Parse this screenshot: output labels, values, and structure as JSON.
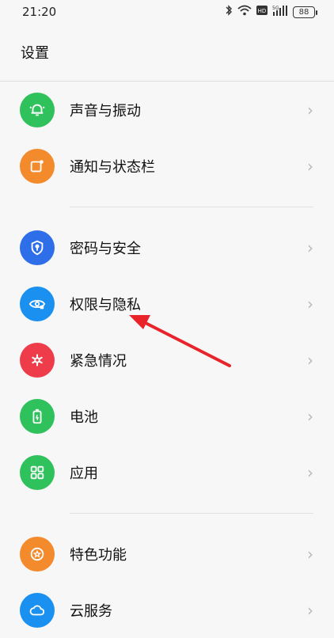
{
  "status": {
    "time": "21:20",
    "battery": "88",
    "net_label": "5G"
  },
  "header": {
    "title": "设置"
  },
  "groups": [
    [
      {
        "label": "声音与振动",
        "color": "#2fc15c",
        "icon": "bell-icon"
      },
      {
        "label": "通知与状态栏",
        "color": "#f38a2c",
        "icon": "notification-icon"
      }
    ],
    [
      {
        "label": "密码与安全",
        "color": "#2e6ee8",
        "icon": "shield-key-icon"
      },
      {
        "label": "权限与隐私",
        "color": "#1a90f0",
        "icon": "eye-lock-icon"
      },
      {
        "label": "紧急情况",
        "color": "#ee3c4a",
        "icon": "emergency-asterisk-icon"
      },
      {
        "label": "电池",
        "color": "#2fc15c",
        "icon": "battery-icon"
      },
      {
        "label": "应用",
        "color": "#2fc15c",
        "icon": "apps-grid-icon"
      }
    ],
    [
      {
        "label": "特色功能",
        "color": "#f38a2c",
        "icon": "star-badge-icon"
      },
      {
        "label": "云服务",
        "color": "#1a90f0",
        "icon": "cloud-icon"
      }
    ]
  ],
  "annotation": {
    "arrow_color": "#e8232a"
  }
}
